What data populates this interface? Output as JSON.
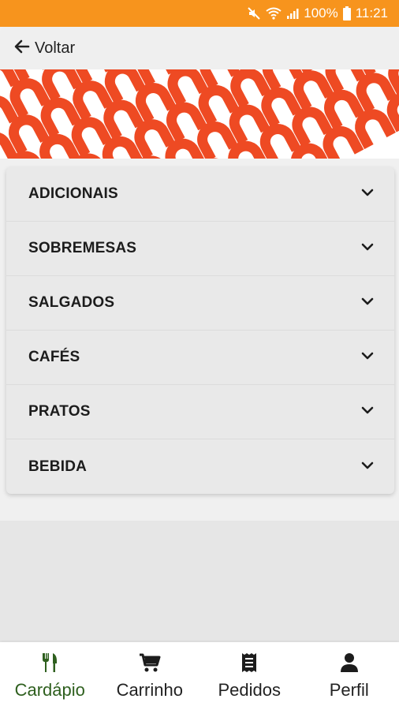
{
  "status_bar": {
    "battery": "100%",
    "time": "11:21",
    "icons": [
      "mute-icon",
      "wifi-icon",
      "signal-icon",
      "battery-icon"
    ]
  },
  "header": {
    "back_label": "Voltar",
    "back_icon": "arrow-left-icon"
  },
  "banner": {
    "pattern_colors": [
      "#ee4a23",
      "#f7941d",
      "#4a7a23",
      "#2f4f17"
    ]
  },
  "categories": [
    {
      "label": "ADICIONAIS",
      "icon": "chevron-down-icon"
    },
    {
      "label": "SOBREMESAS",
      "icon": "chevron-down-icon"
    },
    {
      "label": "SALGADOS",
      "icon": "chevron-down-icon"
    },
    {
      "label": "CAFÉS",
      "icon": "chevron-down-icon"
    },
    {
      "label": "PRATOS",
      "icon": "chevron-down-icon"
    },
    {
      "label": "BEBIDA",
      "icon": "chevron-down-icon"
    }
  ],
  "bottom_nav": {
    "items": [
      {
        "label": "Cardápio",
        "icon": "cutlery-icon",
        "active": true
      },
      {
        "label": "Carrinho",
        "icon": "cart-icon",
        "active": false
      },
      {
        "label": "Pedidos",
        "icon": "receipt-icon",
        "active": false
      },
      {
        "label": "Perfil",
        "icon": "user-icon",
        "active": false
      }
    ]
  },
  "colors": {
    "status_bar": "#f7941d",
    "active_nav": "#2e5f1e"
  }
}
